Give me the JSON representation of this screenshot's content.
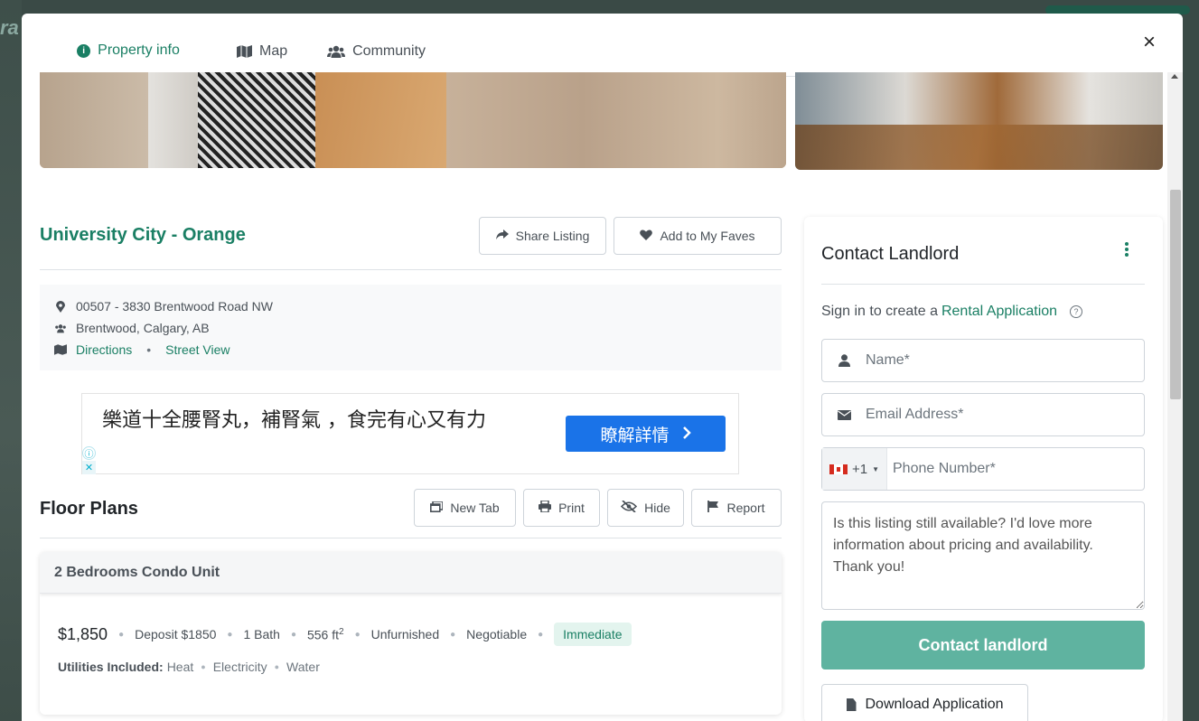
{
  "tabs": {
    "property_info": "Property info",
    "map": "Map",
    "community": "Community"
  },
  "close_icon": "×",
  "listing": {
    "title": "University City - Orange",
    "share_label": "Share Listing",
    "faves_label": "Add to My Faves",
    "address_line1": "00507 - 3830 Brentwood Road NW",
    "address_line2": "Brentwood, Calgary, AB",
    "directions": "Directions",
    "street_view": "Street View",
    "dot": "•"
  },
  "ad": {
    "text": "樂道十全腰腎丸，補腎氣 ，食完有心又有力",
    "button": "瞭解詳情",
    "info": "ⓘ",
    "close": "✕"
  },
  "floor_plans": {
    "title": "Floor Plans",
    "new_tab": "New Tab",
    "print": "Print",
    "hide": "Hide",
    "report": "Report"
  },
  "unit": {
    "name": "2 Bedrooms Condo Unit",
    "price": "$1,850",
    "deposit": "Deposit $1850",
    "bath": "1 Bath",
    "size": "556 ft",
    "size_sup": "2",
    "furnished": "Unfurnished",
    "negotiable": "Negotiable",
    "availability": "Immediate",
    "utilities_label": "Utilities Included:",
    "utilities": [
      "Heat",
      "Electricity",
      "Water"
    ],
    "sep": "●"
  },
  "contact": {
    "title": "Contact Landlord",
    "signin_prefix": "Sign in to create a",
    "signin_link": "Rental Application",
    "name_placeholder": "Name*",
    "email_placeholder": "Email Address*",
    "phone_code": "+1",
    "phone_placeholder": "Phone Number*",
    "message": "Is this listing still available? I'd love more information about pricing and availability. Thank you!",
    "contact_button": "Contact landlord",
    "download_button": "Download Application"
  },
  "colors": {
    "brand": "#1a7f64",
    "contact_button": "#5fb3a0",
    "ad_button": "#1a73e8",
    "badge_bg": "#e3f4ee"
  },
  "icons": {
    "info": "info-circle-icon",
    "map": "map-icon",
    "community": "users-icon",
    "share": "share-icon",
    "heart": "heart-icon",
    "pin": "map-pin-icon",
    "users": "users-icon",
    "directions": "map-icon",
    "new_tab": "window-restore-icon",
    "print": "print-icon",
    "hide": "eye-slash-icon",
    "report": "flag-icon",
    "user": "user-icon",
    "envelope": "envelope-icon",
    "file": "file-icon",
    "kebab": "kebab-menu-icon",
    "question": "question-circle-icon"
  }
}
